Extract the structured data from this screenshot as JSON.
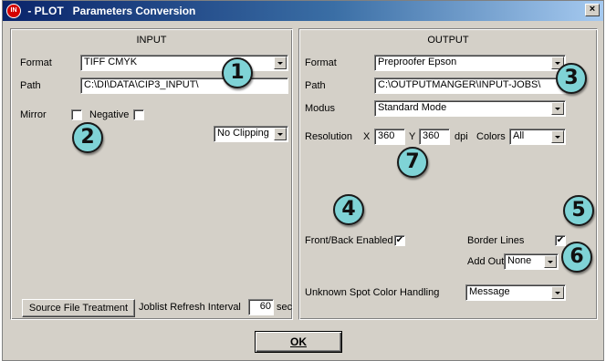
{
  "window": {
    "app_icon_text": "IN",
    "title": " - PLOT   Parameters Conversion",
    "close_label": "×"
  },
  "input": {
    "title": "INPUT",
    "format_label": "Format",
    "format_value": "TIFF CMYK",
    "path_label": "Path",
    "path_value": "C:\\DI\\DATA\\CIP3_INPUT\\",
    "mirror_label": "Mirror",
    "mirror_checked": false,
    "negative_label": "Negative",
    "negative_checked": false,
    "clipping_value": "No Clipping",
    "source_button": "Source File Treatment",
    "refresh_label": "Joblist Refresh Interval",
    "refresh_value": "60",
    "refresh_unit": "sec"
  },
  "output": {
    "title": "OUTPUT",
    "format_label": "Format",
    "format_value": "Preproofer Epson",
    "path_label": "Path",
    "path_value": "C:\\OUTPUTMANGER\\INPUT-JOBS\\",
    "modus_label": "Modus",
    "modus_value": "Standard Mode",
    "resolution_label": "Resolution",
    "x_label": "X",
    "x_value": "360",
    "y_label": "Y",
    "y_value": "360",
    "dpi_label": "dpi",
    "colors_label": "Colors",
    "colors_value": "All",
    "front_back_label": "Front/Back Enabled",
    "front_back_checked": "✔",
    "border_lines_label": "Border Lines",
    "border_lines_checked": "✔",
    "add_out_label": "Add Out",
    "add_out_value": "None",
    "spot_color_label": "Unknown Spot Color Handling",
    "spot_color_value": "Message"
  },
  "ok_button": "OK",
  "callouts": [
    "1",
    "2",
    "3",
    "4",
    "5",
    "6",
    "7"
  ]
}
